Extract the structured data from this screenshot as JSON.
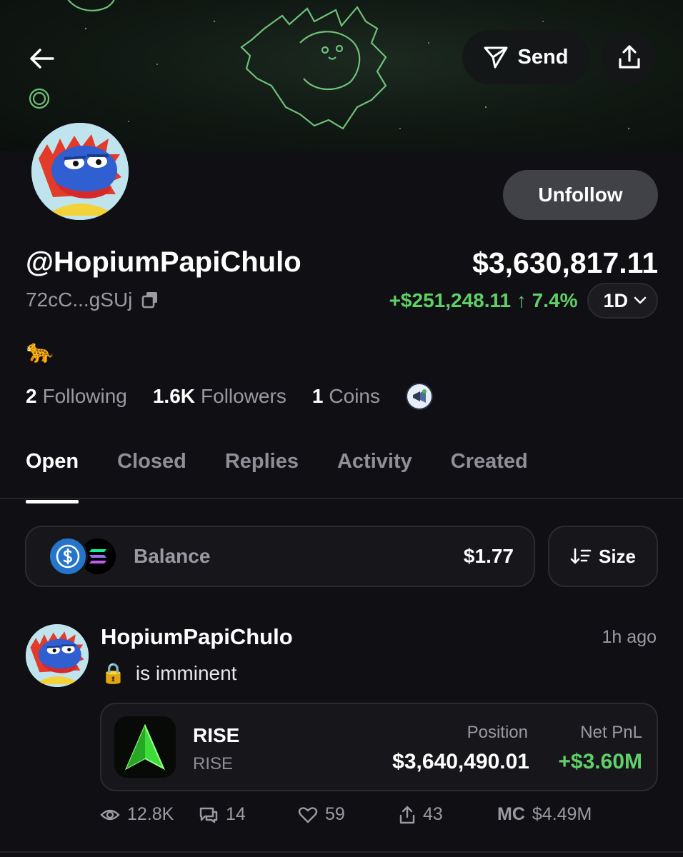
{
  "header": {
    "send_label": "Send"
  },
  "profile": {
    "unfollow_label": "Unfollow",
    "handle": "@HopiumPapiChulo",
    "address": "72cC...gSUj",
    "total_value": "$3,630,817.11",
    "pnl": "+$251,248.11 ↑ 7.4%",
    "period": "1D",
    "bio": "🐆",
    "stats": {
      "following_count": "2",
      "following_label": "Following",
      "followers_count": "1.6K",
      "followers_label": "Followers",
      "coins_count": "1",
      "coins_label": "Coins"
    }
  },
  "tabs": [
    {
      "label": "Open",
      "active": true
    },
    {
      "label": "Closed",
      "active": false
    },
    {
      "label": "Replies",
      "active": false
    },
    {
      "label": "Activity",
      "active": false
    },
    {
      "label": "Created",
      "active": false
    }
  ],
  "balance": {
    "label": "Balance",
    "value": "$1.77",
    "sort_label": "Size"
  },
  "post": {
    "username": "HopiumPapiChulo",
    "time": "1h ago",
    "text": "is imminent",
    "emoji": "🔒",
    "token": {
      "name": "RISE",
      "ticker": "RISE",
      "position_label": "Position",
      "position_value": "$3,640,490.01",
      "pnl_label": "Net PnL",
      "pnl_value": "+$3.60M"
    },
    "metrics": {
      "views": "12.8K",
      "replies": "14",
      "likes": "59",
      "shares": "43",
      "mc_label": "MC",
      "mc_value": "$4.49M"
    }
  },
  "colors": {
    "background": "#101014",
    "positive": "#5fd068",
    "muted": "#9a9aa2",
    "button_gray": "#414148"
  }
}
